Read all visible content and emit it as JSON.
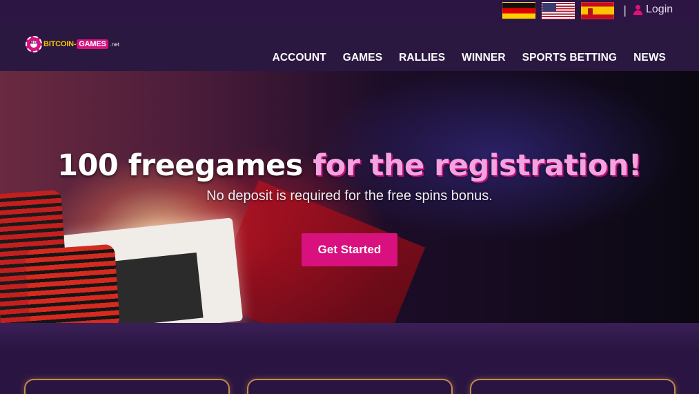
{
  "topbar": {
    "languages": [
      {
        "name": "German",
        "icon": "flag-de-icon"
      },
      {
        "name": "English",
        "icon": "flag-us-icon"
      },
      {
        "name": "Spanish",
        "icon": "flag-es-icon"
      }
    ],
    "separator": "|",
    "login_label": "Login"
  },
  "logo": {
    "chip_text": "BG",
    "text": "BITCOIN-",
    "highlight": "GAMES",
    "suffix": ".net"
  },
  "nav": {
    "items": [
      "ACCOUNT",
      "GAMES",
      "RALLIES",
      "WINNER",
      "SPORTS BETTING",
      "NEWS"
    ]
  },
  "hero": {
    "title_white": "100 freegames ",
    "title_pink": "for the registration!",
    "subtitle": "No deposit is required for the free spins bonus.",
    "cta_label": "Get Started"
  },
  "colors": {
    "accent": "#d8117f",
    "background": "#2a1540",
    "card_border": "#c48a4a"
  }
}
